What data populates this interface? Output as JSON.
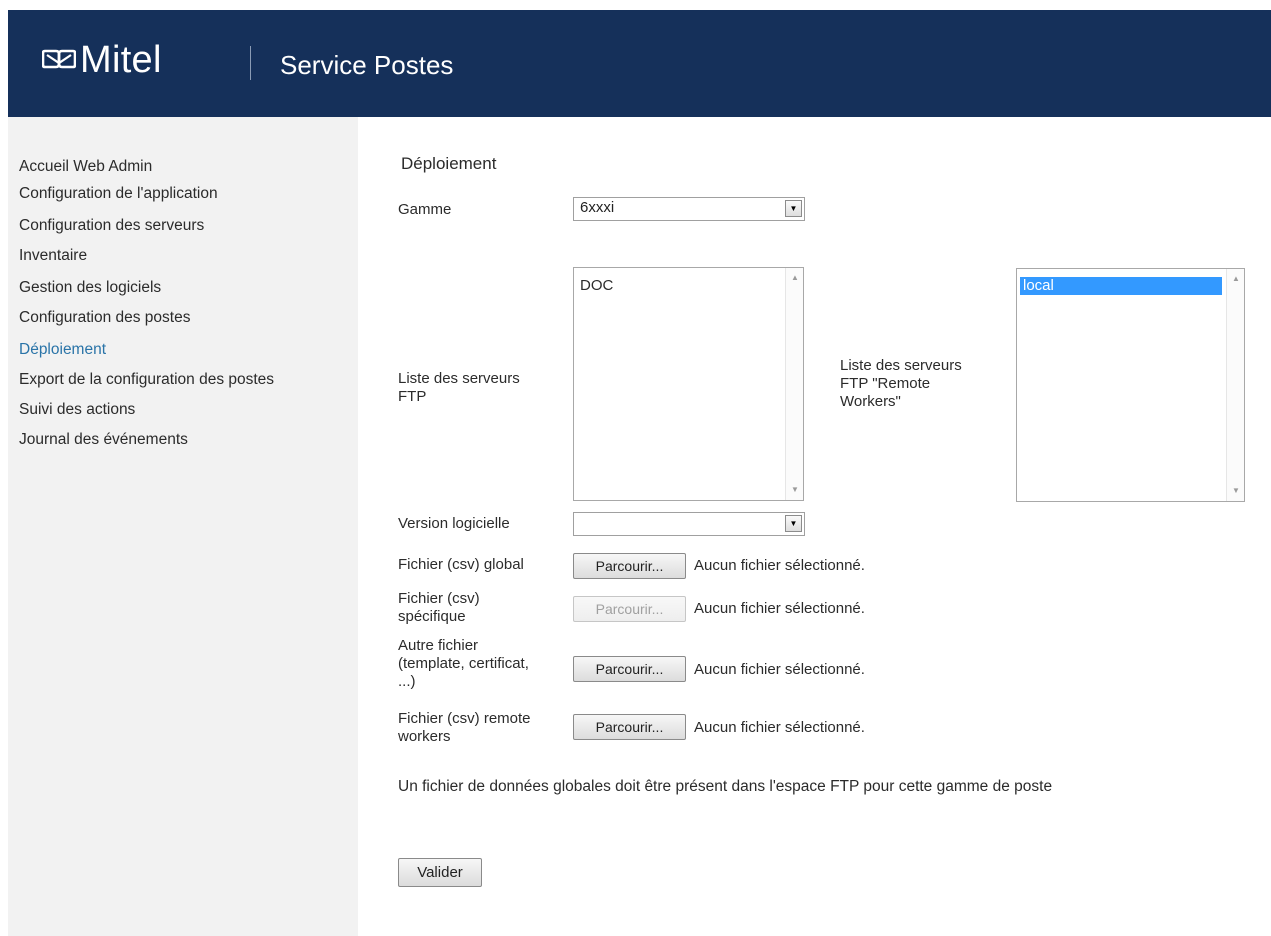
{
  "header": {
    "brand": "Mitel",
    "title": "Service Postes"
  },
  "sidebar": {
    "items": [
      {
        "label": "Accueil Web Admin"
      },
      {
        "label": "Configuration de l'application"
      },
      {
        "label": "Configuration des serveurs"
      },
      {
        "label": "Inventaire"
      },
      {
        "label": "Gestion des logiciels"
      },
      {
        "label": "Configuration des postes"
      },
      {
        "label": "Déploiement",
        "active": true
      },
      {
        "label": "Export de la configuration des postes"
      },
      {
        "label": "Suivi des actions"
      },
      {
        "label": "Journal des événements"
      }
    ]
  },
  "main": {
    "title": "Déploiement",
    "gamme": {
      "label": "Gamme",
      "value": "6xxxi"
    },
    "ftp_list": {
      "label_line1": "Liste des serveurs",
      "label_line2": "FTP",
      "options": [
        "DOC"
      ]
    },
    "remote_ftp_list": {
      "label_line1": "Liste des serveurs",
      "label_line2": "FTP \"Remote",
      "label_line3": "Workers\"",
      "options": [
        "local"
      ],
      "selected": "local"
    },
    "version": {
      "label": "Version logicielle",
      "value": ""
    },
    "files": [
      {
        "label_lines": [
          "Fichier (csv) global"
        ],
        "button": "Parcourir...",
        "status": "Aucun fichier sélectionné.",
        "disabled": false
      },
      {
        "label_lines": [
          "Fichier (csv)",
          "spécifique"
        ],
        "button": "Parcourir...",
        "status": "Aucun fichier sélectionné.",
        "disabled": true
      },
      {
        "label_lines": [
          "Autre fichier",
          "(template, certificat,",
          "...)"
        ],
        "button": "Parcourir...",
        "status": "Aucun fichier sélectionné.",
        "disabled": false
      },
      {
        "label_lines": [
          "Fichier (csv) remote",
          "workers"
        ],
        "button": "Parcourir...",
        "status": "Aucun fichier sélectionné.",
        "disabled": false
      }
    ],
    "notice": "Un fichier de données globales doit être présent dans l'espace FTP pour cette gamme de poste",
    "submit_label": "Valider"
  },
  "colors": {
    "header_bg": "#15305a",
    "sidebar_bg": "#f2f2f2",
    "active_link": "#2a74a8",
    "selected_option": "#3399ff"
  }
}
